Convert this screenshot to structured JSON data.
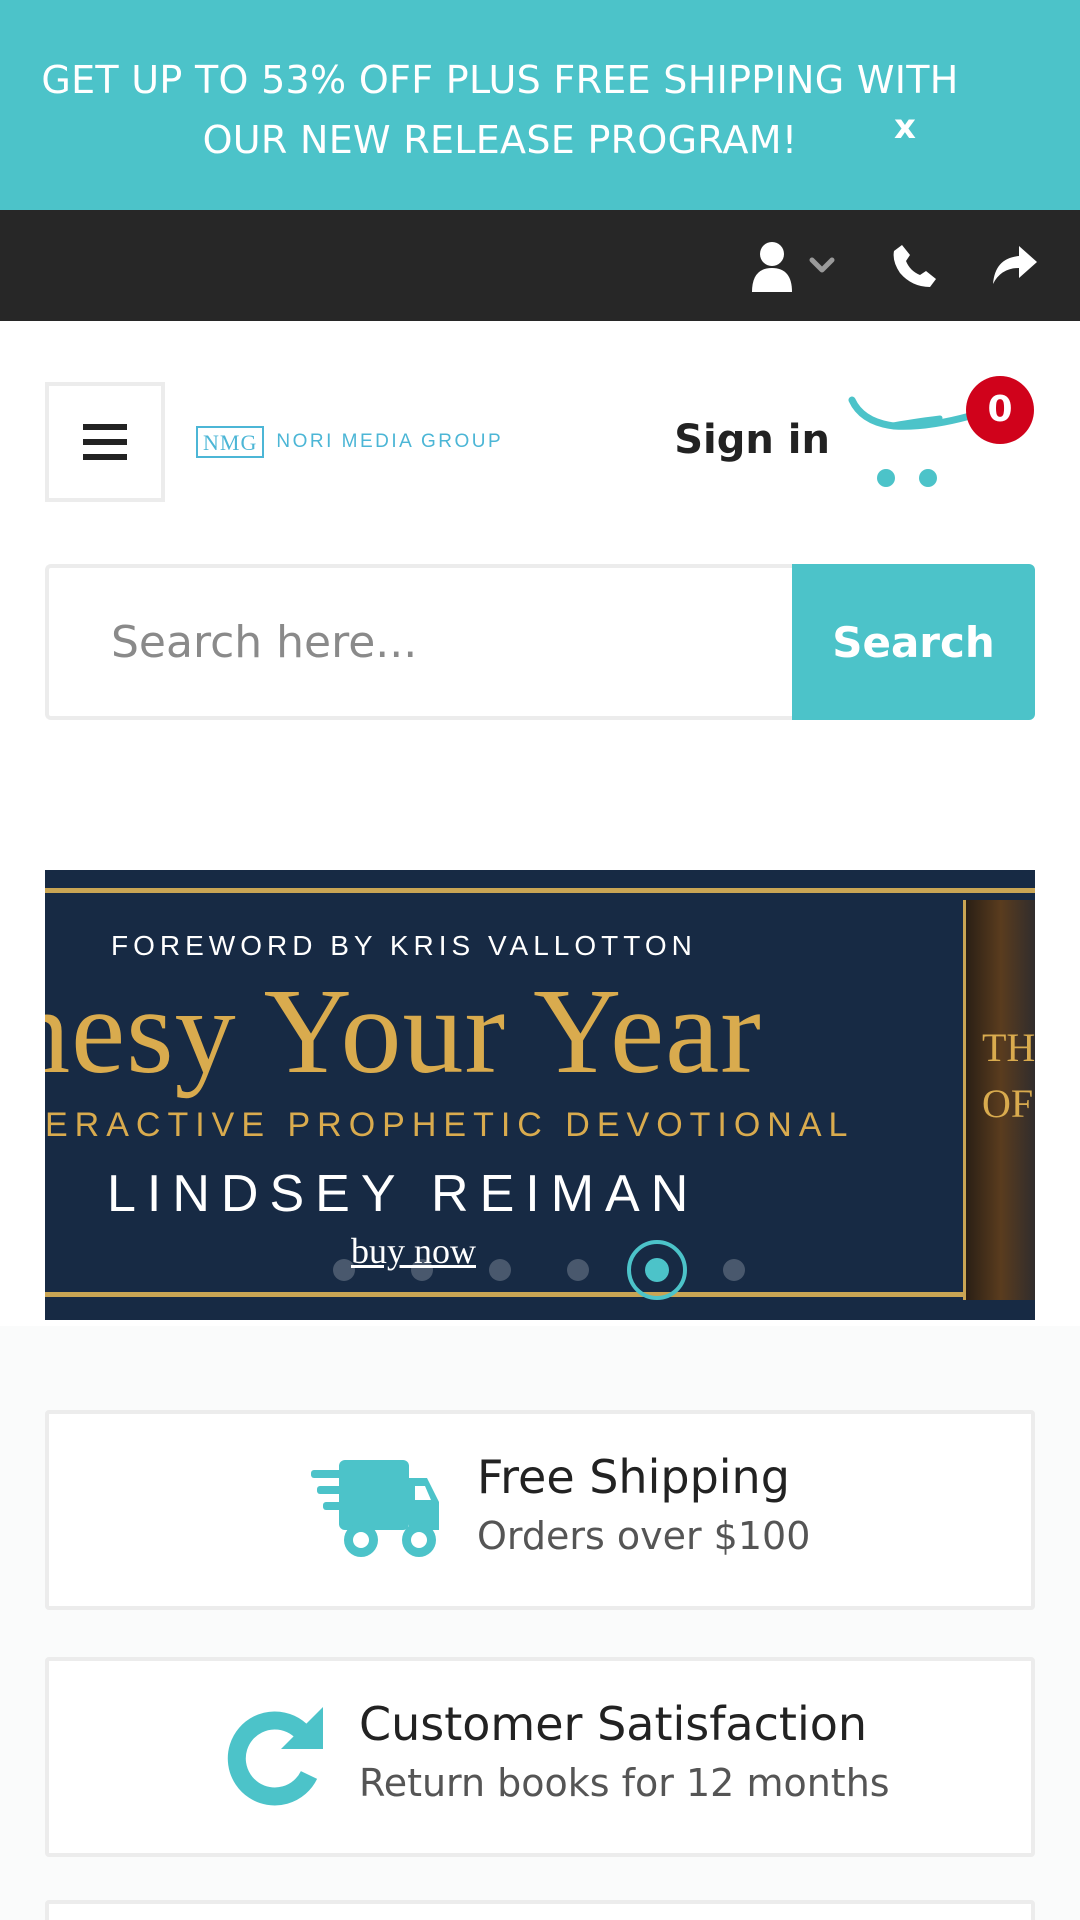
{
  "promo": {
    "text": "GET UP TO 53% OFF PLUS FREE SHIPPING WITH OUR NEW RELEASE PROGRAM!",
    "close_label": "x"
  },
  "topbar": {
    "icons": [
      "user-icon",
      "chevron-down-icon",
      "phone-icon",
      "share-icon"
    ]
  },
  "header": {
    "logo_abbr": "NMG",
    "logo_name": "NORI MEDIA GROUP",
    "signin_label": "Sign in",
    "cart_count": "0"
  },
  "search": {
    "placeholder": "Search here...",
    "button_label": "Search"
  },
  "hero": {
    "foreword": "FOREWORD BY KRIS VALLOTTON",
    "title": "ophesy Your Year",
    "subtitle": "ERACTIVE PROPHETIC DEVOTIONAL",
    "author": "LINDSEY REIMAN",
    "cta": "buy now",
    "book_text": "THE OF",
    "slides_count": 6,
    "active_slide": 5
  },
  "features": [
    {
      "title": "Free Shipping",
      "subtitle": "Orders over $100",
      "icon": "truck-icon"
    },
    {
      "title": "Customer Satisfaction",
      "subtitle": "Return books for 12 months",
      "icon": "redo-icon"
    }
  ],
  "colors": {
    "accent": "#4cc3c9",
    "dark_bar": "#272727",
    "badge": "#d0021b",
    "hero_bg": "#172a44",
    "hero_gold": "#d9ab4e"
  }
}
